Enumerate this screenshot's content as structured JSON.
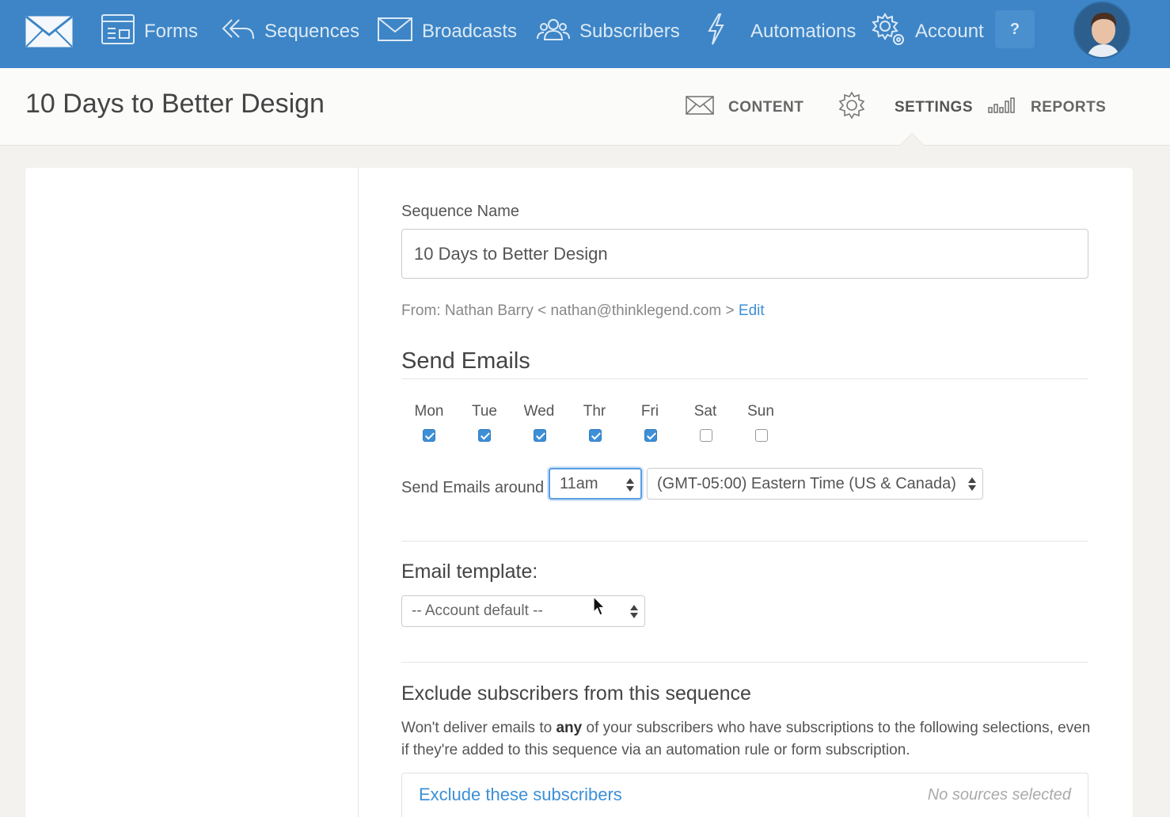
{
  "nav": {
    "items": [
      {
        "label": "Forms",
        "icon": "forms-icon"
      },
      {
        "label": "Sequences",
        "icon": "sequences-icon"
      },
      {
        "label": "Broadcasts",
        "icon": "broadcasts-icon"
      },
      {
        "label": "Subscribers",
        "icon": "subscribers-icon"
      },
      {
        "label": "Automations",
        "icon": "automations-icon"
      },
      {
        "label": "Account",
        "icon": "account-gear-icon"
      }
    ],
    "help_label": "?",
    "brand_color": "#3d85c6"
  },
  "header": {
    "title": "10 Days to Better Design",
    "tabs": [
      {
        "label": "CONTENT",
        "icon": "envelope-icon"
      },
      {
        "label": "SETTINGS",
        "icon": "gear-icon",
        "active": true
      },
      {
        "label": "REPORTS",
        "icon": "bar-chart-icon"
      }
    ]
  },
  "form": {
    "name_label": "Sequence Name",
    "name_value": "10 Days to Better Design",
    "from_prefix": "From: Nathan Barry < nathan@thinklegend.com >",
    "from_edit": "Edit",
    "send_emails_title": "Send Emails",
    "days": [
      {
        "label": "Mon",
        "checked": true
      },
      {
        "label": "Tue",
        "checked": true
      },
      {
        "label": "Wed",
        "checked": true
      },
      {
        "label": "Thr",
        "checked": true
      },
      {
        "label": "Fri",
        "checked": true
      },
      {
        "label": "Sat",
        "checked": false
      },
      {
        "label": "Sun",
        "checked": false
      }
    ],
    "send_around_label": "Send Emails around",
    "time_value": "11am",
    "timezone_value": "(GMT-05:00) Eastern Time (US & Canada)",
    "template_label": "Email template:",
    "template_value": "-- Account default --",
    "exclude_title": "Exclude subscribers from this sequence",
    "exclude_desc_pre": "Won't deliver emails to",
    "exclude_desc_bold": "any",
    "exclude_desc_post": "of your subscribers who have subscriptions to the following selections, even if they're added to this sequence via an automation rule or form subscription.",
    "exclude_link": "Exclude these subscribers",
    "exclude_status": "No sources selected",
    "link_color": "#3d8fd6"
  }
}
